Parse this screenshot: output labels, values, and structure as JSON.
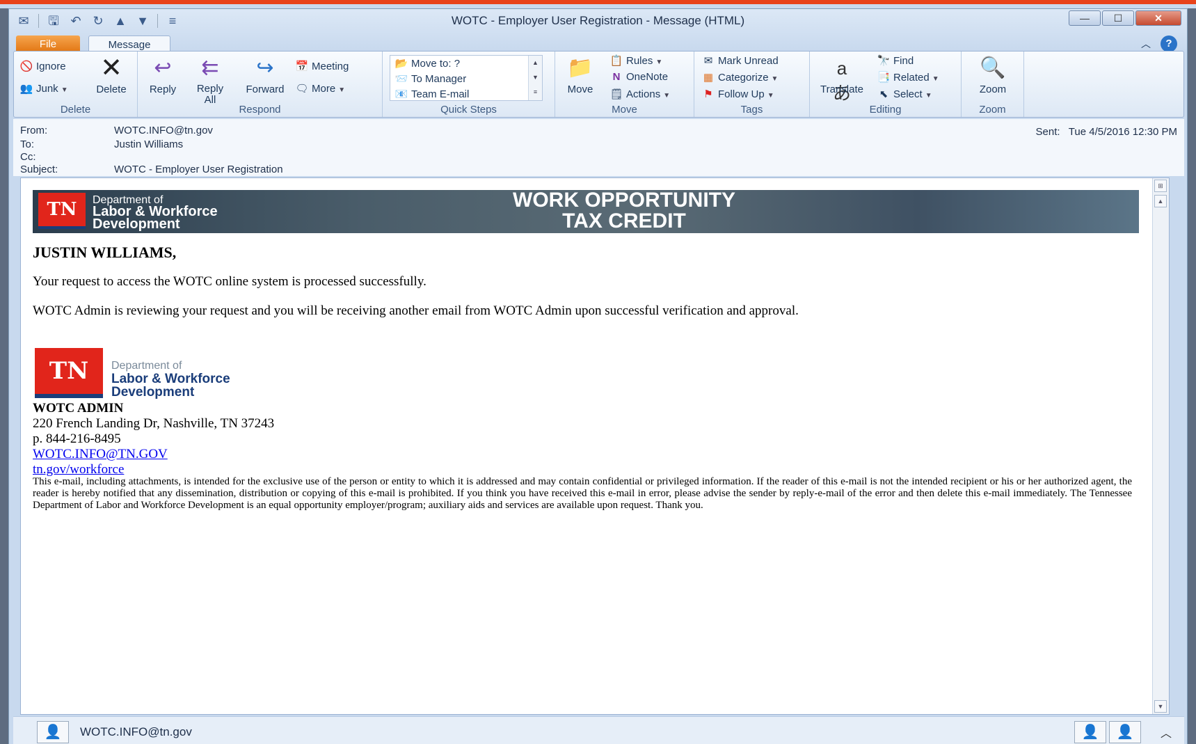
{
  "window": {
    "title": "WOTC - Employer User Registration  -  Message (HTML)",
    "accent": "#e8431b"
  },
  "tabs": {
    "file": "File",
    "message": "Message"
  },
  "ribbon": {
    "delete_group": {
      "ignore": "Ignore",
      "junk": "Junk",
      "delete": "Delete",
      "label": "Delete"
    },
    "respond_group": {
      "reply": "Reply",
      "reply_all_1": "Reply",
      "reply_all_2": "All",
      "forward": "Forward",
      "meeting": "Meeting",
      "more": "More",
      "label": "Respond"
    },
    "quick_steps": {
      "items": [
        "Move to: ?",
        "To Manager",
        "Team E-mail"
      ],
      "label": "Quick Steps"
    },
    "move_group": {
      "move": "Move",
      "rules": "Rules",
      "onenote": "OneNote",
      "actions": "Actions",
      "label": "Move"
    },
    "tags_group": {
      "mark_unread": "Mark Unread",
      "categorize": "Categorize",
      "follow_up": "Follow Up",
      "label": "Tags"
    },
    "editing_group": {
      "translate": "Translate",
      "find": "Find",
      "related": "Related",
      "select": "Select",
      "label": "Editing"
    },
    "zoom_group": {
      "zoom": "Zoom",
      "label": "Zoom"
    }
  },
  "header": {
    "from_label": "From:",
    "from": "WOTC.INFO@tn.gov",
    "to_label": "To:",
    "to": "Justin Williams",
    "cc_label": "Cc:",
    "subject_label": "Subject:",
    "subject": "WOTC - Employer User Registration",
    "sent_label": "Sent:",
    "sent": "Tue 4/5/2016 12:30 PM"
  },
  "banner": {
    "logo": "TN",
    "dept_line1": "Department of",
    "dept_line2": "Labor & Workforce",
    "dept_line3": "Development",
    "title_line1": "WORK OPPORTUNITY",
    "title_line2": "TAX CREDIT"
  },
  "message": {
    "greeting": "JUSTIN WILLIAMS,",
    "p1": "Your request to access the WOTC online system is processed successfully.",
    "p2": "WOTC Admin is reviewing your request and you will be receiving another email from WOTC Admin upon successful verification and approval."
  },
  "signature": {
    "logo": "TN",
    "dept_line1": "Department of",
    "dept_line2": "Labor & Workforce",
    "dept_line3": "Development",
    "name": "WOTC ADMIN",
    "address": "220 French Landing Dr, Nashville, TN 37243",
    "phone": "p. 844-216-8495",
    "email": "WOTC.INFO@TN.GOV",
    "website": "tn.gov/workforce",
    "disclaimer": "This e-mail, including attachments, is intended for the exclusive use of the person or entity to which it is addressed and may contain confidential or privileged information. If the reader of this e-mail is not the intended recipient or his or her authorized agent, the reader is hereby notified that any dissemination, distribution or copying of this e-mail is prohibited. If you think you have received this e-mail in error, please advise the sender by reply-e-mail of the error and then delete this e-mail immediately. The Tennessee Department of Labor and Workforce Development is an equal opportunity employer/program; auxiliary aids and services are available upon request. Thank you."
  },
  "people_pane": {
    "name": "WOTC.INFO@tn.gov"
  }
}
